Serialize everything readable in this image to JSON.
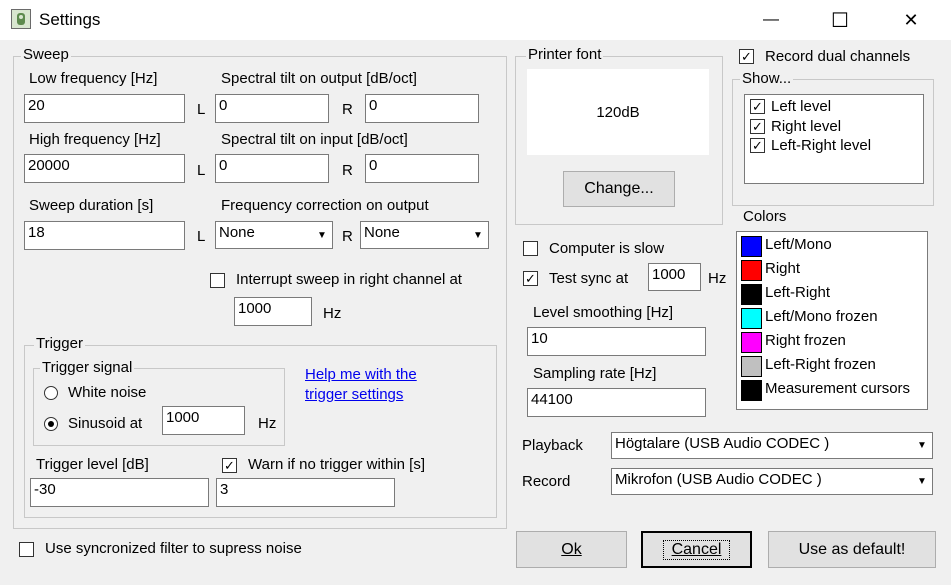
{
  "window": {
    "title": "Settings",
    "minimize": "—",
    "maximize": "☐",
    "close": "✕"
  },
  "sweep": {
    "group": "Sweep",
    "low_freq_label": "Low frequency [Hz]",
    "low_freq_value": "20",
    "high_freq_label": "High frequency [Hz]",
    "high_freq_value": "20000",
    "duration_label": "Sweep duration [s]",
    "duration_value": "18",
    "tilt_output_label": "Spectral tilt on output [dB/oct]",
    "tilt_output_l": "0",
    "tilt_output_r": "0",
    "tilt_input_label": "Spectral tilt on input [dB/oct]",
    "tilt_input_l": "0",
    "tilt_input_r": "0",
    "freq_corr_label": "Frequency correction on output",
    "freq_corr_l": "None",
    "freq_corr_r": "None",
    "l": "L",
    "r": "R",
    "interrupt_label": "Interrupt sweep in right channel at",
    "interrupt_checked": false,
    "interrupt_value": "1000",
    "hz": "Hz"
  },
  "trigger": {
    "group": "Trigger",
    "signal_group": "Trigger signal",
    "white_noise": "White noise",
    "sinusoid": "Sinusoid at",
    "sinusoid_value": "1000",
    "hz": "Hz",
    "help_link_line1": "Help me with the",
    "help_link_line2": "trigger settings",
    "level_label": "Trigger level [dB]",
    "level_value": "-30",
    "warn_label": "Warn if no trigger within [s]",
    "warn_checked": true,
    "warn_value": "3"
  },
  "sync_filter_label": "Use syncronized filter to supress noise",
  "printer": {
    "group": "Printer font",
    "sample": "120dB",
    "change_button": "Change..."
  },
  "computer_slow_label": "Computer is slow",
  "test_sync_label": "Test sync at",
  "test_sync_value": "1000",
  "test_sync_hz": "Hz",
  "level_smoothing_label": "Level smoothing [Hz]",
  "level_smoothing_value": "10",
  "sampling_rate_label": "Sampling rate [Hz]",
  "sampling_rate_value": "44100",
  "record_dual_label": "Record dual channels",
  "show": {
    "group": "Show...",
    "items": [
      "Left level",
      "Right level",
      "Left-Right level"
    ]
  },
  "colors": {
    "label": "Colors",
    "items": [
      {
        "name": "Left/Mono",
        "color": "#0000ff"
      },
      {
        "name": "Right",
        "color": "#ff0000"
      },
      {
        "name": "Left-Right",
        "color": "#000000"
      },
      {
        "name": "Left/Mono frozen",
        "color": "#00ffff"
      },
      {
        "name": "Right frozen",
        "color": "#ff00ff"
      },
      {
        "name": "Left-Right frozen",
        "color": "#c0c0c0"
      },
      {
        "name": "Measurement cursors",
        "color": "#000000"
      }
    ]
  },
  "playback_label": "Playback",
  "playback_value": "Högtalare (USB Audio CODEC )",
  "record_label": "Record",
  "record_value": "Mikrofon (USB Audio CODEC )",
  "buttons": {
    "ok": "Ok",
    "cancel": "Cancel",
    "default": "Use as default!"
  }
}
